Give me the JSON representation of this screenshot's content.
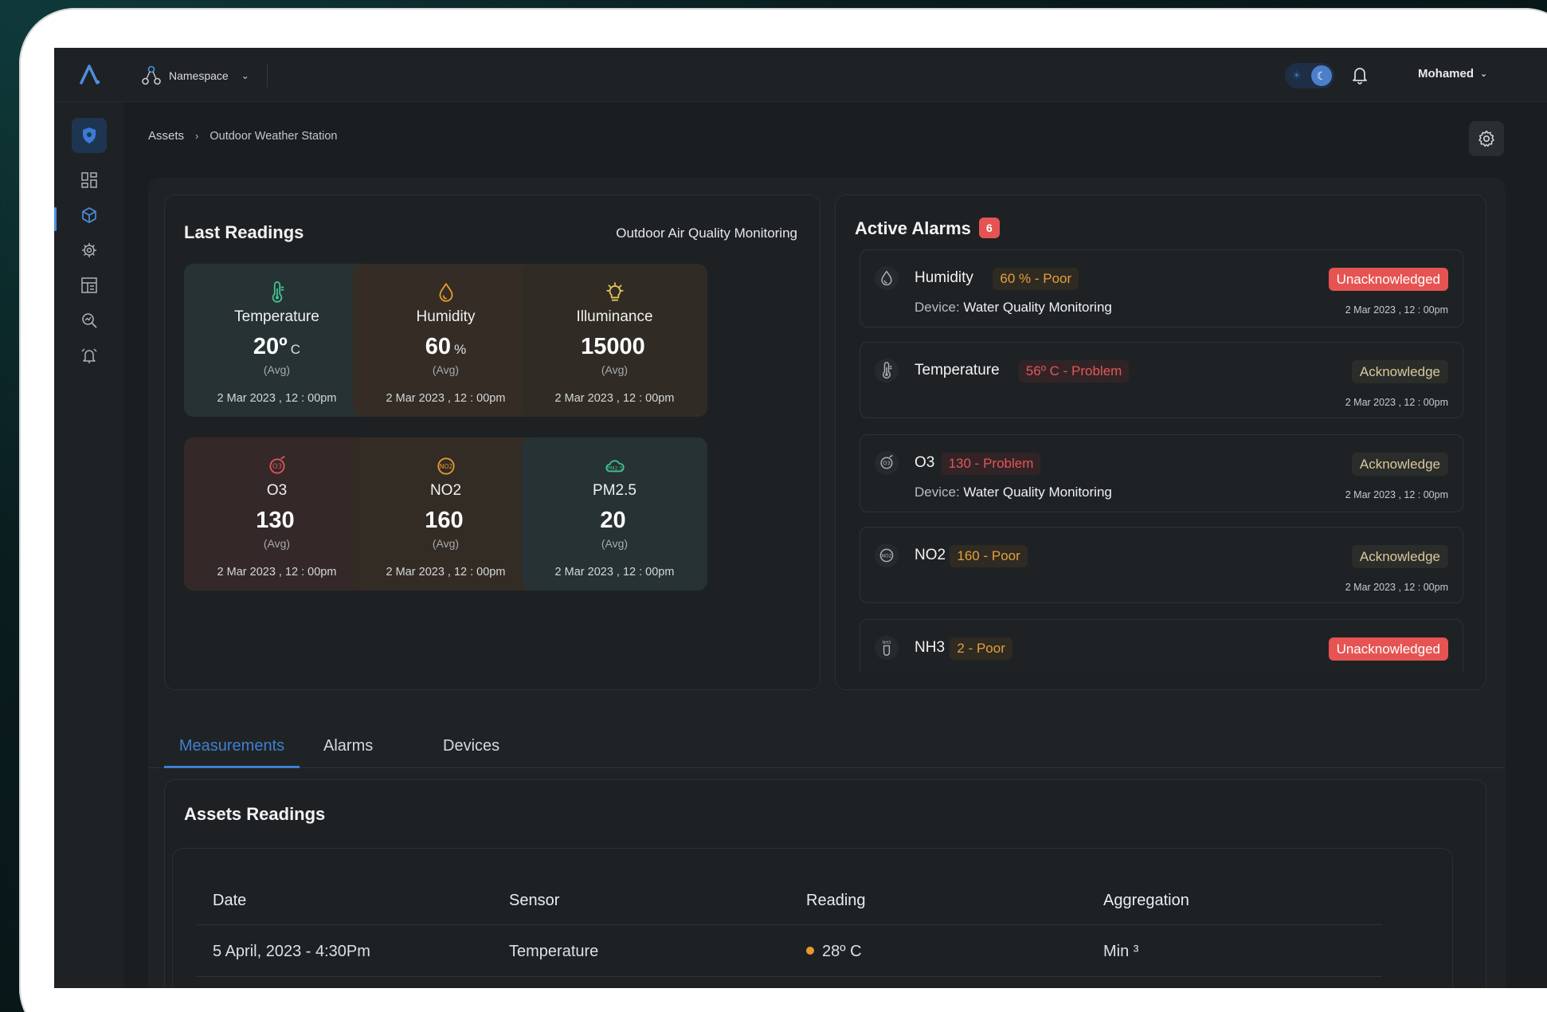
{
  "topbar": {
    "namespace_label": "Namespace",
    "user_name": "Mohamed"
  },
  "breadcrumb": {
    "root": "Assets",
    "current": "Outdoor Weather Station"
  },
  "last_readings": {
    "title": "Last Readings",
    "subtitle": "Outdoor Air Quality Monitoring",
    "tiles": [
      {
        "name": "Temperature",
        "value": "20º",
        "unit": "C",
        "avg": "(Avg)",
        "time": "2 Mar 2023 , 12 : 00pm",
        "icon": "thermometer-icon",
        "bg": "#263234",
        "icon_color": "#43c08f"
      },
      {
        "name": "Humidity",
        "value": "60",
        "unit": "%",
        "avg": "(Avg)",
        "time": "2 Mar 2023 , 12 : 00pm",
        "icon": "droplet-icon",
        "bg": "#342c25",
        "icon_color": "#e59a2f"
      },
      {
        "name": "Illuminance",
        "value": "15000",
        "unit": "",
        "avg": "(Avg)",
        "time": "2 Mar 2023 , 12 : 00pm",
        "icon": "bulb-icon",
        "bg": "#302c25",
        "icon_color": "#e7c05a"
      },
      {
        "name": "O3",
        "value": "130",
        "unit": "",
        "avg": "(Avg)",
        "time": "2 Mar 2023 , 12 : 00pm",
        "icon": "o3-icon",
        "bg": "#352829",
        "icon_color": "#e0575a"
      },
      {
        "name": "NO2",
        "value": "160",
        "unit": "",
        "avg": "(Avg)",
        "time": "2 Mar 2023 , 12 : 00pm",
        "icon": "no2-icon",
        "bg": "#332c25",
        "icon_color": "#e59a2f"
      },
      {
        "name": "PM2.5",
        "value": "20",
        "unit": "",
        "avg": "(Avg)",
        "time": "2 Mar 2023 , 12 : 00pm",
        "icon": "pm25-cloud-icon",
        "bg": "#263234",
        "icon_color": "#43c08f"
      }
    ]
  },
  "alarms": {
    "title": "Active Alarms",
    "count": "6",
    "items": [
      {
        "name": "Humidity",
        "tag": "60 % - Poor",
        "severity": "poor",
        "device_label": "Device:",
        "device": "Water Quality Monitoring",
        "state": "Unacknowledged",
        "state_type": "unack",
        "time": "2 Mar 2023 , 12 : 00pm",
        "icon": "droplet-icon"
      },
      {
        "name": "Temperature",
        "tag": "56º C - Problem",
        "severity": "problem",
        "device_label": "",
        "device": "",
        "state": "Acknowledge",
        "state_type": "ack",
        "time": "2 Mar 2023 , 12 : 00pm",
        "icon": "thermometer-icon"
      },
      {
        "name": "O3",
        "tag": "130 - Problem",
        "severity": "problem",
        "device_label": "Device:",
        "device": "Water Quality Monitoring",
        "state": "Acknowledge",
        "state_type": "ack",
        "time": "2 Mar 2023 , 12 : 00pm",
        "icon": "o3-icon"
      },
      {
        "name": "NO2",
        "tag": "160 - Poor",
        "severity": "poor",
        "device_label": "",
        "device": "",
        "state": "Acknowledge",
        "state_type": "ack",
        "time": "2 Mar 2023 , 12 : 00pm",
        "icon": "no2-icon"
      },
      {
        "name": "NH3",
        "tag": "2 - Poor",
        "severity": "poor",
        "device_label": "",
        "device": "",
        "state": "Unacknowledged",
        "state_type": "unack",
        "time": "",
        "icon": "nh3-icon"
      }
    ]
  },
  "tabs": [
    "Measurements",
    "Alarms",
    "Devices"
  ],
  "assets_readings": {
    "title": "Assets Readings",
    "columns": [
      "Date",
      "Sensor",
      "Reading",
      "Aggregation"
    ],
    "rows": [
      {
        "date": "5 April, 2023 - 4:30Pm",
        "sensor": "Temperature",
        "reading": "28º C",
        "aggregation": "Min ³",
        "dot_color": "#e69b2f"
      }
    ]
  },
  "colors": {
    "accent": "#3f7fd0",
    "danger": "#e55452",
    "warning": "#e2a13c"
  }
}
